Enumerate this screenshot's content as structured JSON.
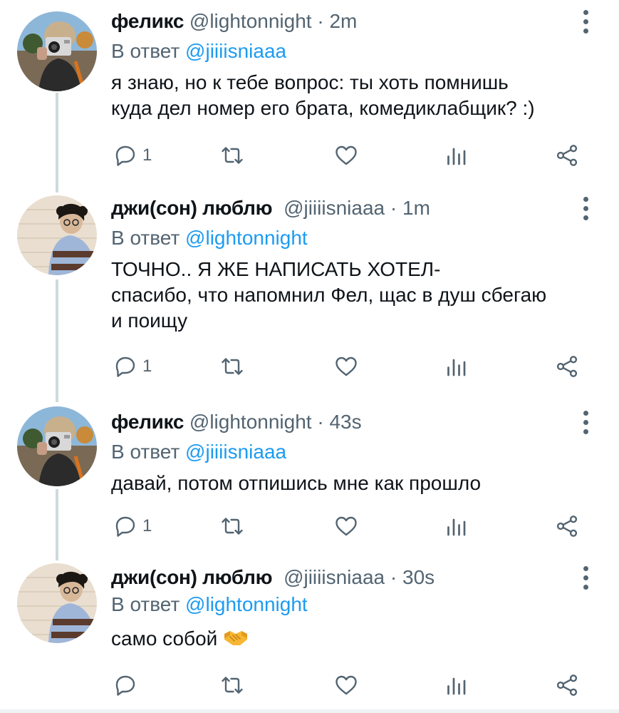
{
  "tweets": [
    {
      "name": "феликс",
      "handle": "@lightonnight",
      "dot": "·",
      "time": "2m",
      "reply_prefix": "В ответ",
      "reply_mention": "@jiiiisniaaa",
      "text_lines": [
        "я знаю, но к тебе вопрос: ты хоть помнишь",
        "куда дел номер его брата, комедиклабщик? :)"
      ],
      "reply_count": "1",
      "avatar": "camera-selfie"
    },
    {
      "name": "джи(сон) люблю",
      "handle": "@jiiiisniaaa",
      "dot": "·",
      "time": "1m",
      "reply_prefix": "В ответ",
      "reply_mention": "@lightonnight",
      "text_lines": [
        "ТОЧНО.. Я ЖЕ НАПИСАТЬ ХОТЕЛ-",
        "спасибо, что напомнил Фел, щас в душ сбегаю",
        "и поищу"
      ],
      "reply_count": "1",
      "avatar": "curly-hair-sweater"
    },
    {
      "name": "феликс",
      "handle": "@lightonnight",
      "dot": "·",
      "time": "43s",
      "reply_prefix": "В ответ",
      "reply_mention": "@jiiiisniaaa",
      "text_lines": [
        "давай, потом отпишись мне как прошло"
      ],
      "reply_count": "1",
      "avatar": "camera-selfie"
    },
    {
      "name": "джи(сон) люблю",
      "handle": "@jiiiisniaaa",
      "dot": "·",
      "time": "30s",
      "reply_prefix": "В ответ",
      "reply_mention": "@lightonnight",
      "text_lines": [
        "само собой"
      ],
      "text_emoji": "handshake",
      "reply_count": "",
      "avatar": "curly-hair-sweater"
    }
  ],
  "icons": {
    "reply": "reply-icon",
    "retweet": "retweet-icon",
    "like": "heart-icon",
    "analytics": "analytics-icon",
    "share": "share-icon",
    "more": "more-vertical-icon"
  },
  "colors": {
    "accent": "#1d9bf0",
    "secondary_text": "#536471",
    "thread_line": "#cfd9de"
  }
}
